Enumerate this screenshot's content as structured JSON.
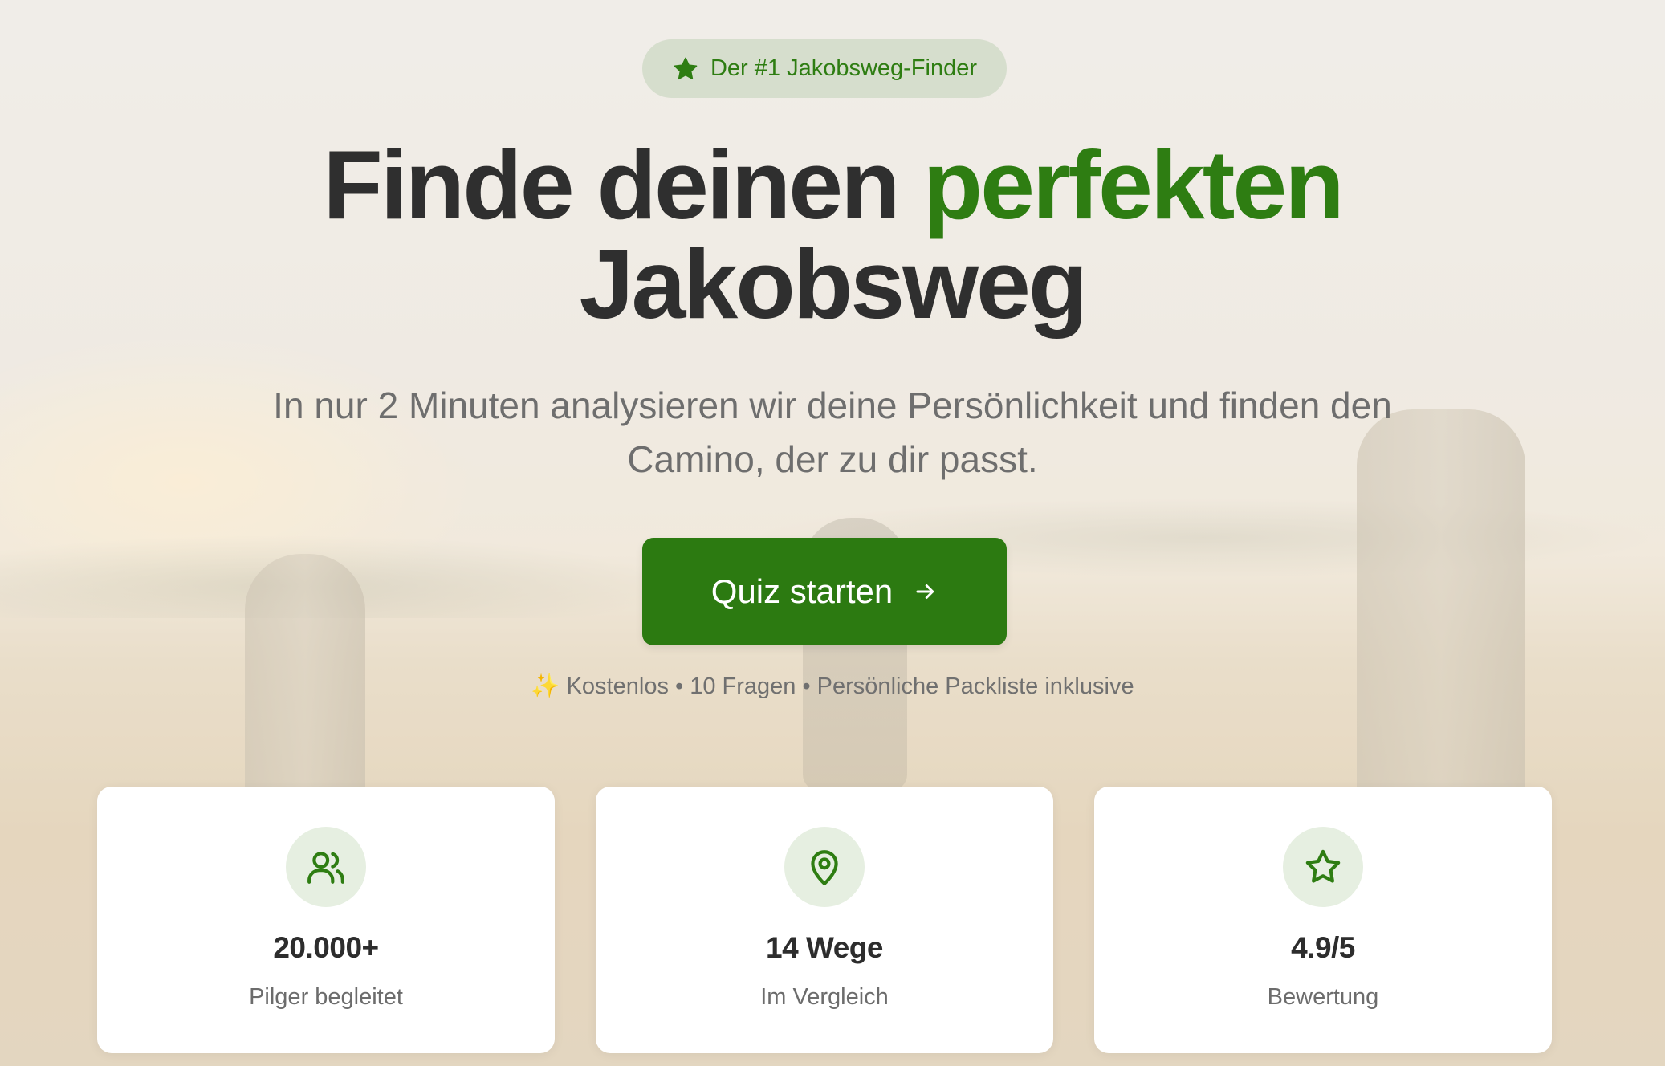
{
  "hero": {
    "badge": {
      "icon": "star-filled-icon",
      "text": "Der #1 Jakobsweg-Finder"
    },
    "title_part1": "Finde deinen ",
    "title_accent": "perfekten",
    "title_part2": "Jakobsweg",
    "subtitle": "In nur 2 Minuten analysieren wir deine Persönlichkeit und finden den Camino, der zu dir passt.",
    "cta": {
      "label": "Quiz starten",
      "icon": "arrow-right-icon"
    },
    "note": "✨ Kostenlos • 10 Fragen • Persönliche Packliste inklusive"
  },
  "stats": [
    {
      "icon": "users-icon",
      "value": "20.000+",
      "label": "Pilger begleitet"
    },
    {
      "icon": "map-pin-icon",
      "value": "14 Wege",
      "label": "Im Vergleich"
    },
    {
      "icon": "star-outline-icon",
      "value": "4.9/5",
      "label": "Bewertung"
    }
  ],
  "colors": {
    "accent": "#2e7d12",
    "button": "#2c7a11",
    "icon_bg": "#e6efe1",
    "title": "#2f2f2f"
  }
}
